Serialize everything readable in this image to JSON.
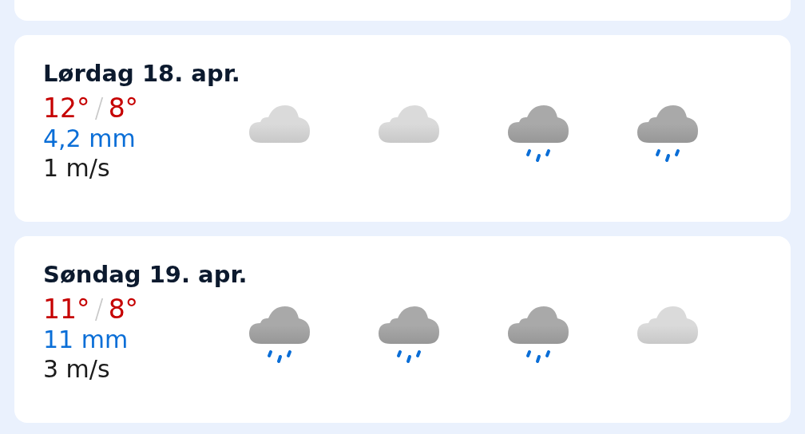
{
  "days": [
    {
      "title": "Lørdag 18. apr.",
      "high": "12°",
      "separator": "/",
      "low": "8°",
      "precipitation": "4,2 mm",
      "wind": "1 m/s",
      "icons": [
        {
          "kind": "light-cloud"
        },
        {
          "kind": "light-cloud"
        },
        {
          "kind": "rain"
        },
        {
          "kind": "rain"
        }
      ]
    },
    {
      "title": "Søndag 19. apr.",
      "high": "11°",
      "separator": "/",
      "low": "8°",
      "precipitation": "11 mm",
      "wind": "3 m/s",
      "icons": [
        {
          "kind": "rain"
        },
        {
          "kind": "rain"
        },
        {
          "kind": "rain"
        },
        {
          "kind": "light-cloud"
        }
      ]
    }
  ]
}
